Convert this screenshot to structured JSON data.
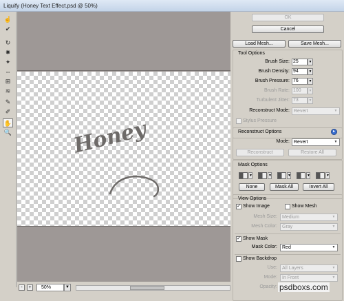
{
  "window": {
    "title": "Liquify (Honey Text Effect.psd @ 50%)"
  },
  "tools": [
    {
      "icon": "forward-warp-icon",
      "glyph": "☝"
    },
    {
      "icon": "reconstruct-icon",
      "glyph": "✔"
    },
    {
      "icon": "twirl-clockwise-icon",
      "glyph": "↻"
    },
    {
      "icon": "pucker-icon",
      "glyph": "✸"
    },
    {
      "icon": "bloat-icon",
      "glyph": "✦"
    },
    {
      "icon": "push-left-icon",
      "glyph": "⇔"
    },
    {
      "icon": "mirror-icon",
      "glyph": "⊞"
    },
    {
      "icon": "turbulence-icon",
      "glyph": "≋"
    },
    {
      "icon": "freeze-mask-icon",
      "glyph": "✎"
    },
    {
      "icon": "thaw-mask-icon",
      "glyph": "✐"
    },
    {
      "icon": "hand-icon",
      "glyph": "✋"
    },
    {
      "icon": "zoom-icon",
      "glyph": "🔍"
    }
  ],
  "canvas": {
    "text": "Honey"
  },
  "status": {
    "zoom": "50%",
    "minus": "-",
    "plus": "+"
  },
  "buttons": {
    "ok": "OK",
    "cancel": "Cancel",
    "load_mesh": "Load Mesh...",
    "save_mesh": "Save Mesh..."
  },
  "tool_options": {
    "title": "Tool Options",
    "brush_size_label": "Brush Size:",
    "brush_size": "25",
    "brush_density_label": "Brush Density:",
    "brush_density": "94",
    "brush_pressure_label": "Brush Pressure:",
    "brush_pressure": "76",
    "brush_rate_label": "Brush Rate:",
    "brush_rate": "100",
    "turbulent_jitter_label": "Turbulent Jitter:",
    "turbulent_jitter": "73",
    "reconstruct_mode_label": "Reconstruct Mode:",
    "reconstruct_mode": "Revert",
    "stylus_pressure_label": "Stylus Pressure"
  },
  "reconstruct_options": {
    "title": "Reconstruct Options",
    "mode_label": "Mode:",
    "mode": "Revert",
    "reconstruct_btn": "Reconstruct",
    "restore_all_btn": "Restore All"
  },
  "mask_options": {
    "title": "Mask Options",
    "none_btn": "None",
    "mask_all_btn": "Mask All",
    "invert_all_btn": "Invert All"
  },
  "view_options": {
    "title": "View Options",
    "show_image_label": "Show Image",
    "show_mesh_label": "Show Mesh",
    "mesh_size_label": "Mesh Size:",
    "mesh_size": "Medium",
    "mesh_color_label": "Mesh Color:",
    "mesh_color": "Gray",
    "show_mask_label": "Show Mask",
    "mask_color_label": "Mask Color:",
    "mask_color": "Red",
    "show_backdrop_label": "Show Backdrop",
    "use_label": "Use:",
    "use": "All Layers",
    "mode_label": "Mode:",
    "mode": "In Front",
    "opacity_label": "Opacity:"
  },
  "watermark": "psdboxs.com"
}
